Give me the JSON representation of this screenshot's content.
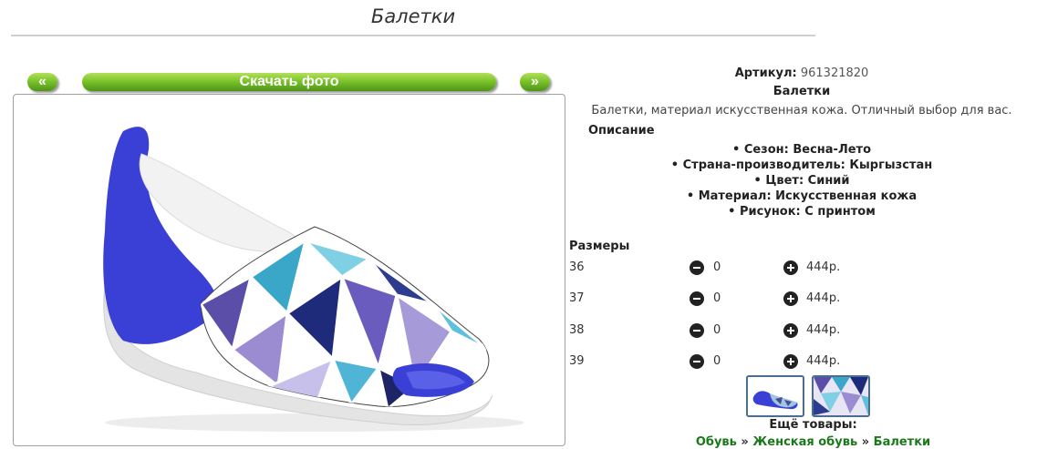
{
  "page": {
    "title": "Балетки"
  },
  "gallery": {
    "prev_label": "«",
    "download_label": "Скачать фото",
    "next_label": "»"
  },
  "product": {
    "article_label": "Артикул:",
    "article_value": "961321820",
    "name": "Балетки",
    "description": "Балетки, материал искусственная кожа. Отличный выбор для вас.",
    "description_heading": "Описание",
    "properties": [
      "Сезон: Весна-Лето",
      "Страна-производитель: Кыргызстан",
      "Цвет: Синий",
      "Материал: Искусственная кожа",
      "Рисунок: С принтом"
    ]
  },
  "sizes": {
    "heading": "Размеры",
    "rows": [
      {
        "size": "36",
        "qty": "0",
        "price": "444р."
      },
      {
        "size": "37",
        "qty": "0",
        "price": "444р."
      },
      {
        "size": "38",
        "qty": "0",
        "price": "444р."
      },
      {
        "size": "39",
        "qty": "0",
        "price": "444р."
      }
    ]
  },
  "more": {
    "label": "Ещё товары:",
    "crumbs": [
      "Обувь",
      "Женская обувь",
      "Балетки"
    ],
    "separator": "»"
  },
  "colors": {
    "button_green": "#7cc42c",
    "link_green": "#1a7a1a",
    "shoe_blue": "#3a3fd6"
  }
}
